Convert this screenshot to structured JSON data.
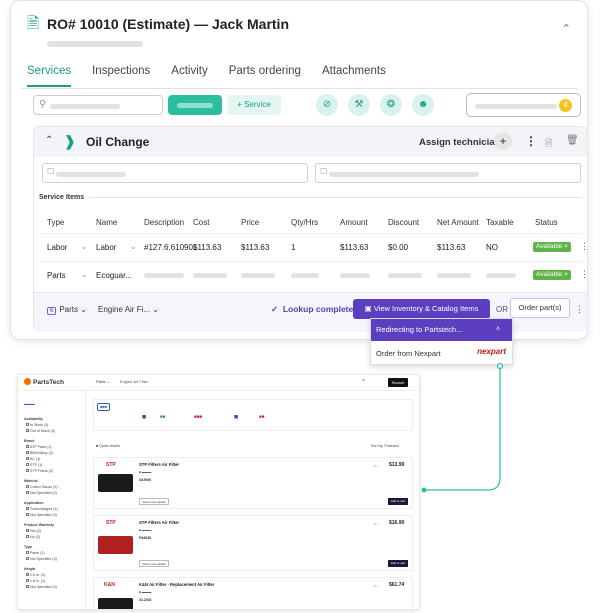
{
  "header": {
    "title": "RO# 10010 (Estimate) — Jack Martin"
  },
  "tabs": [
    {
      "label": "Services",
      "active": true
    },
    {
      "label": "Inspections"
    },
    {
      "label": "Activity"
    },
    {
      "label": "Parts ordering"
    },
    {
      "label": "Attachments"
    }
  ],
  "toolbar": {
    "add_service_label": "+ Service",
    "technician_count": "4"
  },
  "service": {
    "name": "Oil Change",
    "assign_label": "Assign technician",
    "items_label": "Service Items",
    "columns": [
      "Type",
      "Name",
      "Description",
      "Cost",
      "Price",
      "Qty/Hrs",
      "Amount",
      "Discount",
      "Net Amount",
      "Taxable",
      "Status"
    ],
    "rows": [
      {
        "type": "Labor",
        "name": "Labor",
        "description": "#127.6.61090L",
        "cost": "$113.63",
        "price": "$113.63",
        "qty": "1",
        "amount": "$113.63",
        "discount": "$0.00",
        "net": "$113.63",
        "taxable": "NO",
        "status": "Available"
      },
      {
        "type": "Parts",
        "name": "Ecoguar...",
        "status": "Available"
      }
    ]
  },
  "footer": {
    "parts_label": "Parts",
    "engine_label": "Engine Air Fi...",
    "lookup_label": "Lookup complete",
    "view_label": "View Inventory & Catalog Items",
    "or_label": "OR",
    "order_label": "Order part(s)"
  },
  "popup": {
    "title": "Redirecting to Partstech...",
    "item": "Order from Nexpart",
    "logo_text": "nexpart"
  },
  "partstech": {
    "brand": "PartsTech",
    "query_type": "Parts",
    "query": "Engine Air Filter",
    "search_label": "Search",
    "sort_label": "Sort by: Featured",
    "sidebar": [
      "Availability",
      "In Stock (3)",
      "Out of Stock (3)",
      "Brand",
      "ATP Parts (1)",
      "BMW/Alloy (3)",
      "AC (1)",
      "STP (1)",
      "STP Filters (2)",
      "Material",
      "Cotton Gauze (2)",
      "Not Specified (4)",
      "Application",
      "Turbocharged (1)",
      "Not Specified (5)",
      "Product Warranty",
      "Yes (2)",
      "No (3)",
      "Type",
      "Panel (2)",
      "Not Specified (4)",
      "Height",
      "1.6 in. (1)",
      "1.8 in. (1)",
      "Not Specified (4)"
    ],
    "products": [
      {
        "title": "STP Filters Air Filter",
        "price": "$13.99",
        "number": "SA9000",
        "logo": "STP"
      },
      {
        "title": "STP Filters Air Filter",
        "price": "$16.90",
        "number": "PA6638",
        "logo": "STP"
      },
      {
        "title": "K&N Air Filter - Replacement Air Filter",
        "price": "$61.74",
        "number": "33-2304",
        "logo": "K&N"
      }
    ],
    "view_more": "View more details",
    "add_cart": "Add to cart"
  }
}
